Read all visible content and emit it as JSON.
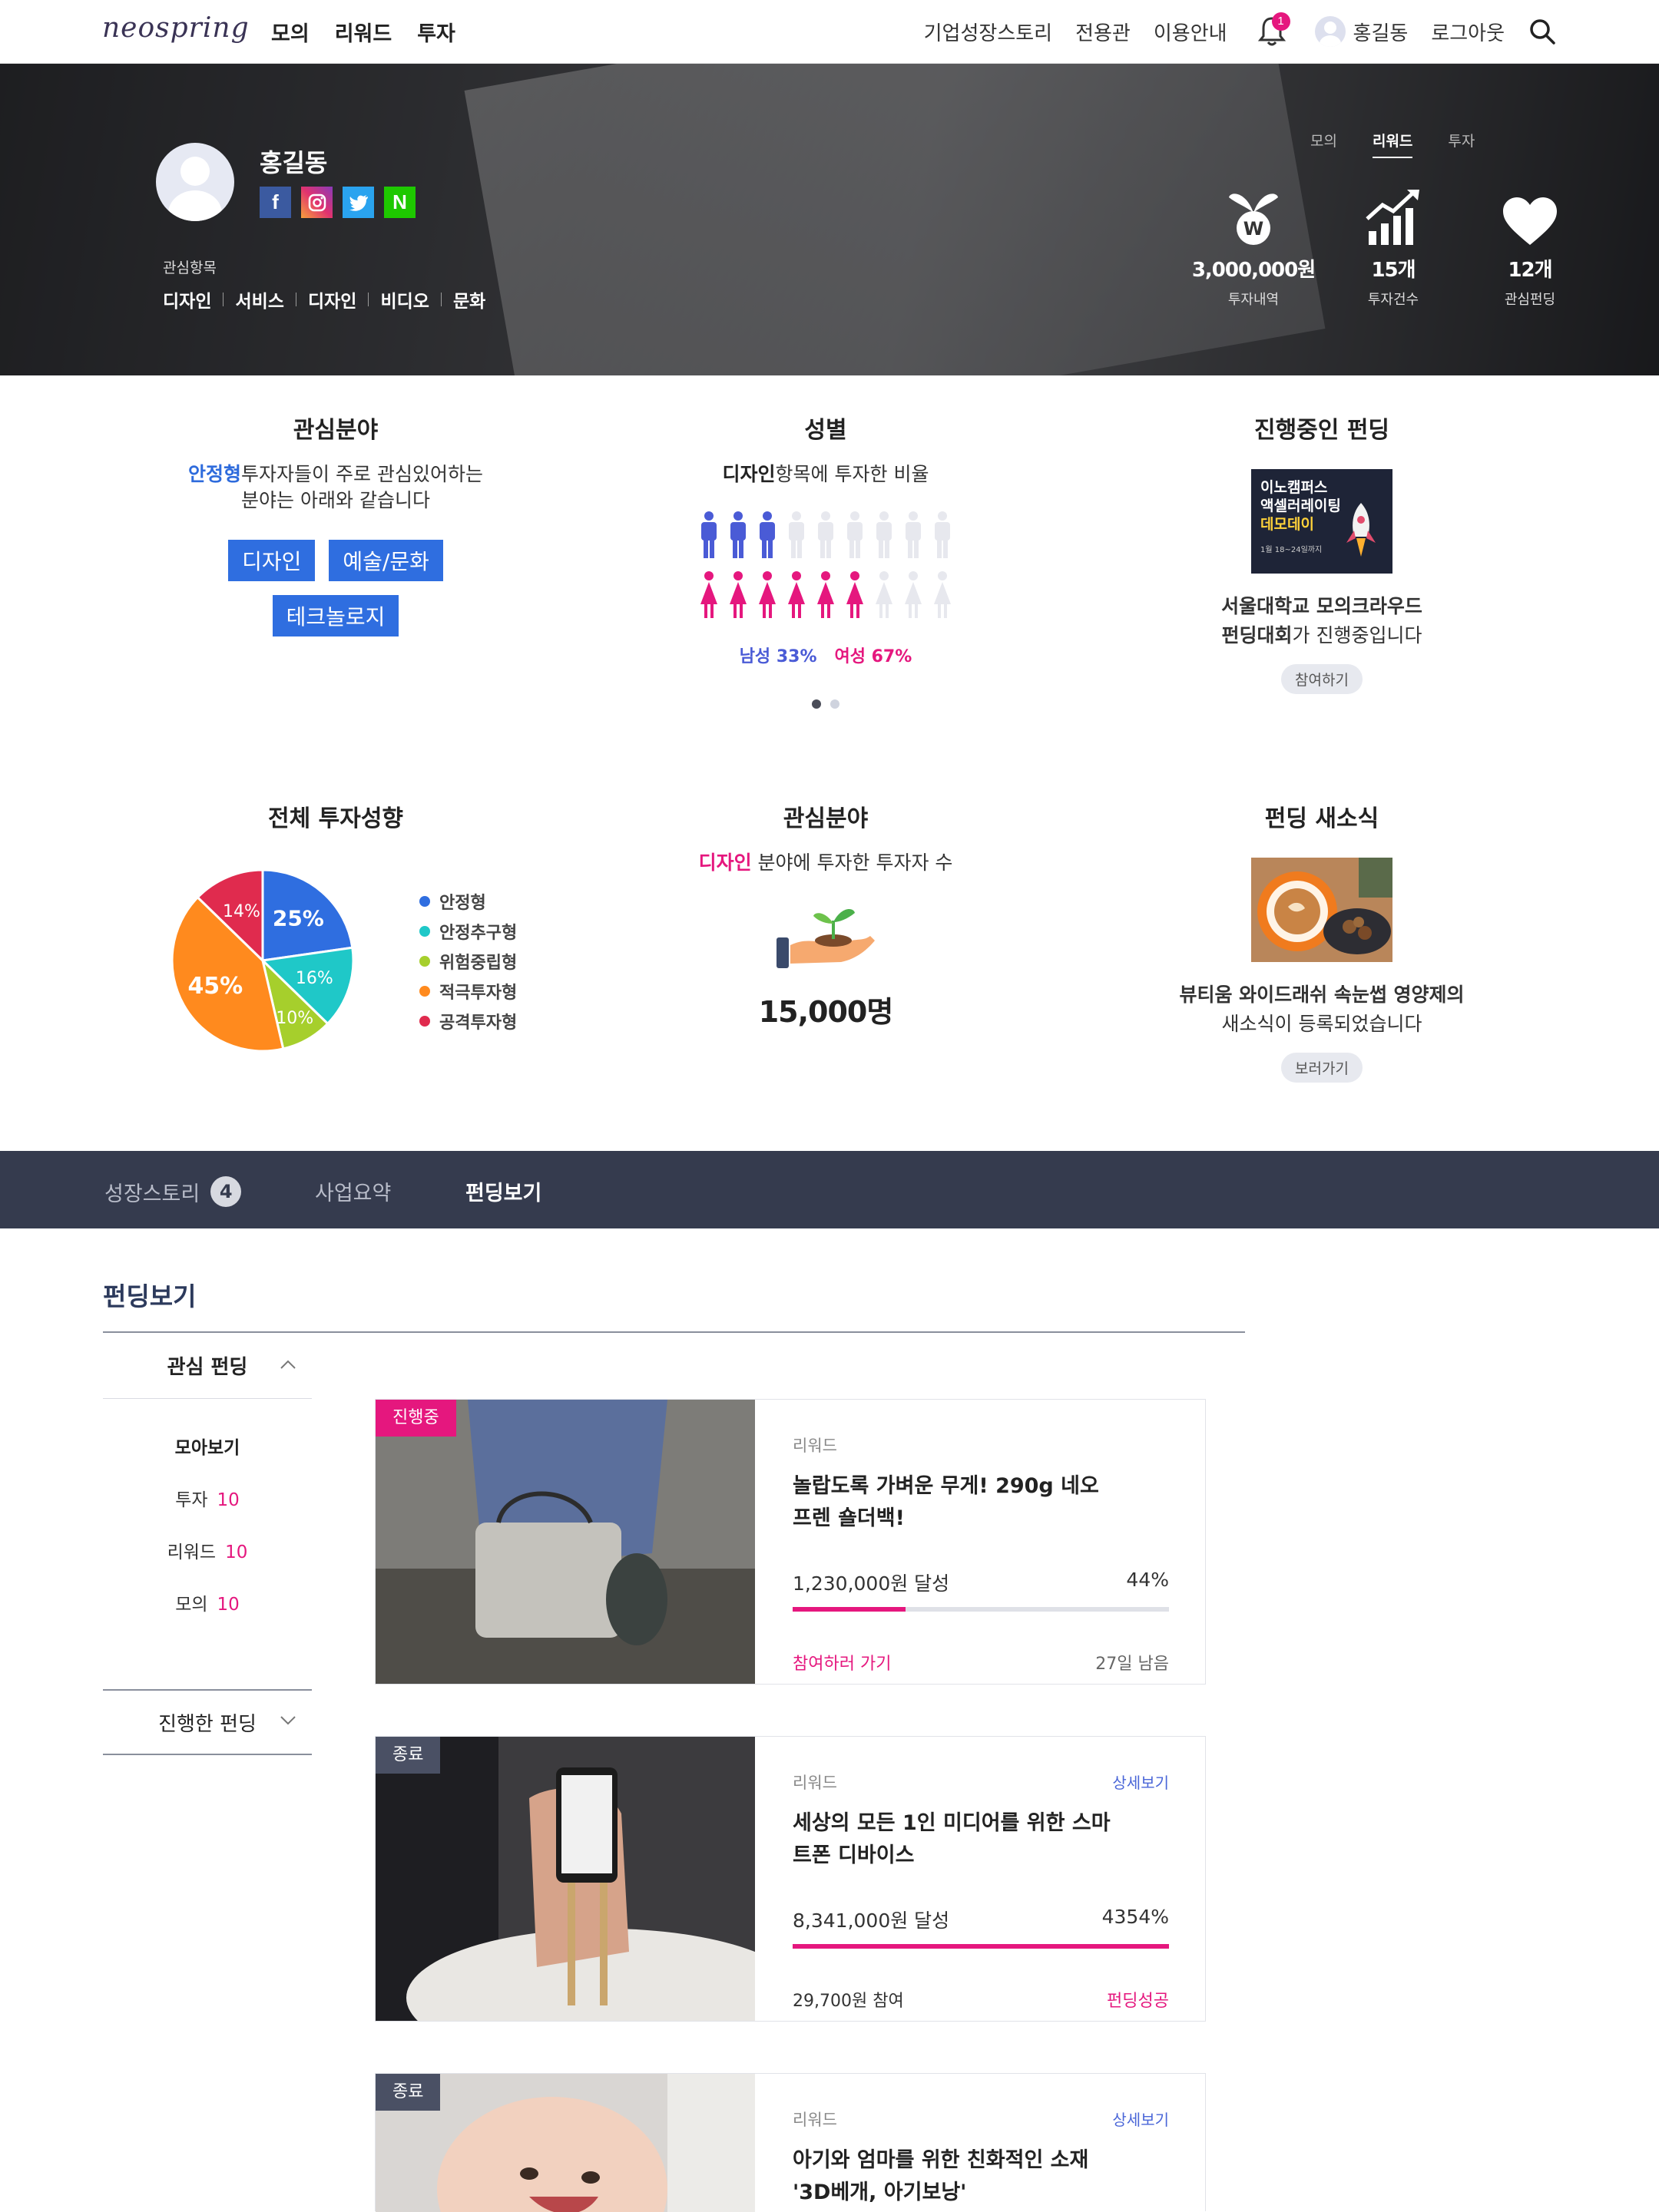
{
  "nav": {
    "logo": "neospring",
    "main": [
      "모의",
      "리워드",
      "투자"
    ],
    "links": [
      "기업성장스토리",
      "전용관",
      "이용안내"
    ],
    "notification_count": "1",
    "user_name": "홍길동",
    "logout": "로그아웃"
  },
  "profile": {
    "name": "홍길동",
    "social_icons": [
      "facebook-icon",
      "instagram-icon",
      "twitter-icon",
      "naver-icon"
    ],
    "interest_label": "관심항목",
    "interests": [
      "디자인",
      "서비스",
      "디자인",
      "비디오",
      "문화"
    ],
    "tabs": [
      "모의",
      "리워드",
      "투자"
    ],
    "active_tab": "리워드",
    "stats": [
      {
        "value": "3,000,000원",
        "label": "투자내역",
        "icon": "won-sprout-icon"
      },
      {
        "value": "15개",
        "label": "투자건수",
        "icon": "growth-chart-icon"
      },
      {
        "value": "12개",
        "label": "관심펀딩",
        "icon": "heart-icon"
      }
    ]
  },
  "cards": {
    "interest": {
      "title": "관심분야",
      "highlight": "안정형",
      "desc_1": "투자자들이 주로 관심있어하는",
      "desc_2": "분야는 아래와 같습니다",
      "tags": [
        "디자인",
        "예술/문화",
        "테크놀로지"
      ]
    },
    "gender": {
      "title": "성별",
      "highlight": "디자인",
      "desc": "항목에 투자한 비율",
      "male_label": "남성 33%",
      "female_label": "여성 67%",
      "male_ratio": 0.33,
      "female_ratio": 0.67
    },
    "ongoing": {
      "title": "진행중인 펀딩",
      "thumb_line1": "이노캠퍼스",
      "thumb_line2": "액셀러레이팅",
      "thumb_line3": "데모데이",
      "thumb_date": "1월 18~24일까지",
      "line1": "서울대학교 모의크라우드",
      "line2_bold": "펀딩대회",
      "line2": "가 진행중입니다",
      "button": "참여하기"
    },
    "overall": {
      "title": "전체 투자성향"
    },
    "interest2": {
      "title": "관심분야",
      "highlight": "디자인",
      "desc": " 분야에 투자한 투자자 수",
      "count": "15,000명"
    },
    "news": {
      "title": "펀딩 새소식",
      "line1": "뷰티움 와이드래쉬 속눈썹 영양제의",
      "line2": "새소식이 등록되었습니다",
      "button": "보러가기"
    }
  },
  "chart_data": {
    "type": "pie",
    "categories": [
      "안정형",
      "안정추구형",
      "위험중립형",
      "적극투자형",
      "공격투자형"
    ],
    "values": [
      25,
      16,
      10,
      45,
      14
    ],
    "labels": [
      "25%",
      "16%",
      "10%",
      "45%",
      "14%"
    ],
    "colors": [
      "#2f6ee0",
      "#1fc8c8",
      "#a6cf2c",
      "#ff8a1e",
      "#e02b4e"
    ]
  },
  "tabbar": {
    "story": "성장스토리",
    "story_count": "4",
    "summary": "사업요약",
    "funding": "펀딩보기"
  },
  "funding": {
    "title": "펀딩보기",
    "side_title": "관심 펀딩",
    "side_items": [
      {
        "label": "모아보기",
        "count": ""
      },
      {
        "label": "투자",
        "count": "10"
      },
      {
        "label": "리워드",
        "count": "10"
      },
      {
        "label": "모의",
        "count": "10"
      }
    ],
    "side_title2": "진행한 펀딩",
    "items": [
      {
        "status": "진행중",
        "status_color": "#e5177e",
        "category": "리워드",
        "detail": "",
        "title": "놀랍도록 가벼운 무게! 290g 네오프렌 숄더백!",
        "amount": "1,230,000원 달성",
        "percent": "44%",
        "progress": 0.3,
        "foot_left": "참여하러 가기",
        "foot_right": "27일 남음"
      },
      {
        "status": "종료",
        "status_color": "#4a5064",
        "category": "리워드",
        "detail": "상세보기",
        "title": "세상의 모든 1인 미디어를 위한 스마트폰 디바이스",
        "amount": "8,341,000원 달성",
        "percent": "4354%",
        "progress": 1,
        "foot_left": "29,700원 참여",
        "foot_right": "펀딩성공"
      },
      {
        "status": "종료",
        "status_color": "#4a5064",
        "category": "리워드",
        "detail": "상세보기",
        "title": "아기와 엄마를 위한 친화적인 소재 '3D베개, 아기보낭'"
      }
    ]
  }
}
